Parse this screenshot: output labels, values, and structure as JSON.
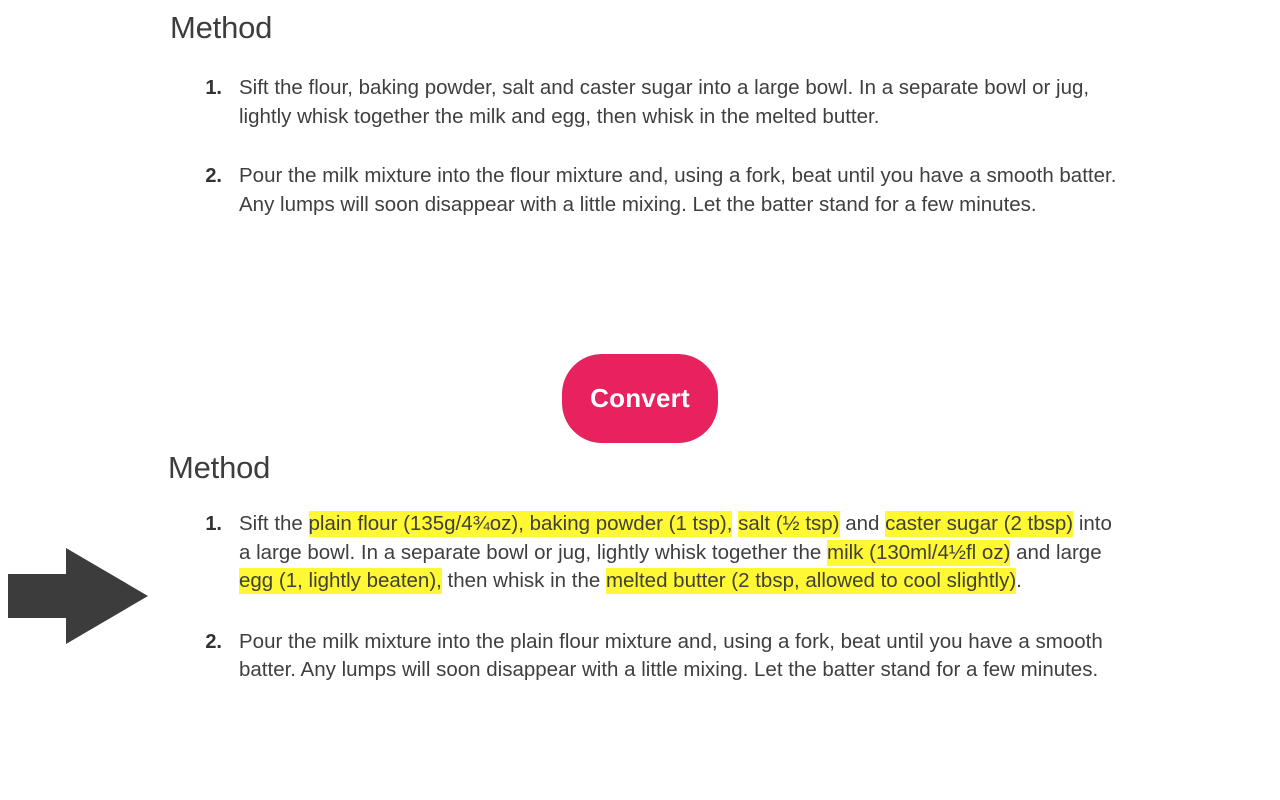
{
  "before": {
    "heading": "Method",
    "steps": [
      {
        "number": "1.",
        "text": "Sift the flour, baking powder, salt and caster sugar into a large bowl. In a separate bowl or jug, lightly whisk together the milk and egg, then whisk in the melted butter."
      },
      {
        "number": "2.",
        "text": "Pour the milk mixture into the flour mixture and, using a fork, beat until you have a smooth batter. Any lumps will soon disappear with a little mixing. Let the batter stand for a few minutes."
      }
    ]
  },
  "convert": {
    "label": "Convert",
    "color": "#e8225f",
    "text_color": "#ffffff"
  },
  "after": {
    "heading": "Method",
    "highlight_color": "#fff832",
    "steps": [
      {
        "number": "1.",
        "segments": [
          {
            "text": "Sift the ",
            "highlight": false
          },
          {
            "text": "plain flour (135g/4¾oz), baking powder (1 tsp),",
            "highlight": true
          },
          {
            "text": " ",
            "highlight": false
          },
          {
            "text": "salt (½ tsp)",
            "highlight": true
          },
          {
            "text": " and ",
            "highlight": false
          },
          {
            "text": "caster sugar (2 tbsp)",
            "highlight": true
          },
          {
            "text": " into a large bowl. In a separate bowl or jug, lightly whisk together the ",
            "highlight": false
          },
          {
            "text": "milk (130ml/4½fl oz)",
            "highlight": true
          },
          {
            "text": " and large ",
            "highlight": false
          },
          {
            "text": "egg (1, lightly beaten),",
            "highlight": true
          },
          {
            "text": " then whisk in the ",
            "highlight": false
          },
          {
            "text": "melted butter (2 tbsp, allowed to cool slightly)",
            "highlight": true
          },
          {
            "text": ".",
            "highlight": false
          }
        ]
      },
      {
        "number": "2.",
        "segments": [
          {
            "text": "Pour the milk mixture into the plain flour mixture and, using a fork, beat until you have a smooth batter. Any lumps will soon disappear with a little mixing. Let the batter stand for a few minutes.",
            "highlight": false
          }
        ]
      }
    ]
  },
  "arrow": {
    "name": "right-arrow-annotation",
    "color": "#3c3c3c"
  }
}
